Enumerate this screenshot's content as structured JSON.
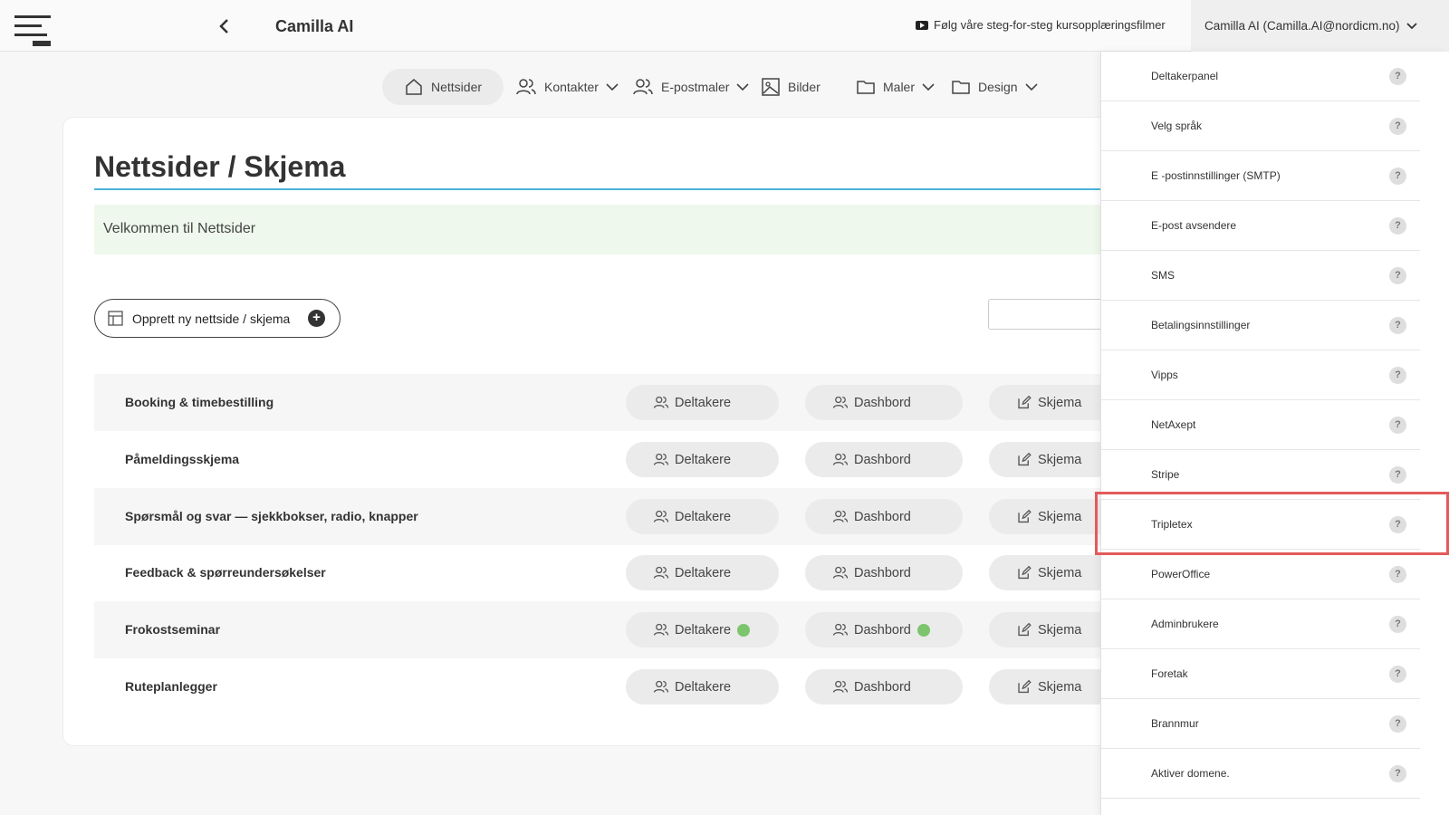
{
  "header": {
    "title": "Camilla AI",
    "tutorial_link": "Følg våre steg-for-steg kursopplæringsfilmer",
    "user": "Camilla AI (Camilla.AI@nordicm.no)"
  },
  "nav": {
    "nettsider": "Nettsider",
    "kontakter": "Kontakter",
    "epostmaler": "E-postmaler",
    "bilder": "Bilder",
    "maler": "Maler",
    "design": "Design"
  },
  "main": {
    "title": "Nettsider / Skjema",
    "welcome": "Velkommen til Nettsider",
    "create_button": "Opprett ny nettside / skjema",
    "search_placeholder": "",
    "rows": [
      {
        "name": "Booking & timebestilling",
        "deltakere": "Deltakere",
        "dashbord": "Dashbord",
        "skjema": "Skjema"
      },
      {
        "name": "Påmeldingsskjema",
        "deltakere": "Deltakere",
        "dashbord": "Dashbord",
        "skjema": "Skjema"
      },
      {
        "name": "Spørsmål og svar — sjekkbokser, radio, knapper",
        "deltakere": "Deltakere",
        "dashbord": "Dashbord",
        "skjema": "Skjema"
      },
      {
        "name": "Feedback & spørreundersøkelser",
        "deltakere": "Deltakere",
        "dashbord": "Dashbord",
        "skjema": "Skjema"
      },
      {
        "name": "Frokostseminar",
        "deltakere": "Deltakere",
        "dashbord": "Dashbord",
        "skjema": "Skjema"
      },
      {
        "name": "Ruteplanlegger",
        "deltakere": "Deltakere",
        "dashbord": "Dashbord",
        "skjema": "Skjema"
      }
    ]
  },
  "dropdown": {
    "items": [
      {
        "label": "Deltakerpanel",
        "help": "?"
      },
      {
        "label": "Velg språk",
        "help": "?"
      },
      {
        "label": "E -postinnstillinger (SMTP)",
        "help": "?"
      },
      {
        "label": "E-post avsendere",
        "help": "?"
      },
      {
        "label": "SMS",
        "help": "?"
      },
      {
        "label": "Betalingsinnstillinger",
        "help": "?"
      },
      {
        "label": "Vipps",
        "help": "?"
      },
      {
        "label": "NetAxept",
        "help": "?"
      },
      {
        "label": "Stripe",
        "help": "?"
      },
      {
        "label": "Tripletex",
        "help": "?"
      },
      {
        "label": "PowerOffice",
        "help": "?"
      },
      {
        "label": "Adminbrukere",
        "help": "?"
      },
      {
        "label": "Foretak",
        "help": "?"
      },
      {
        "label": "Brannmur",
        "help": "?"
      },
      {
        "label": "Aktiver domene.",
        "help": "?"
      }
    ]
  },
  "colors": {
    "accent_line": "#4ab4d8",
    "welcome_bg": "#eff8ed",
    "status_dot": "#7cc46e",
    "highlight": "#e45a5a"
  }
}
